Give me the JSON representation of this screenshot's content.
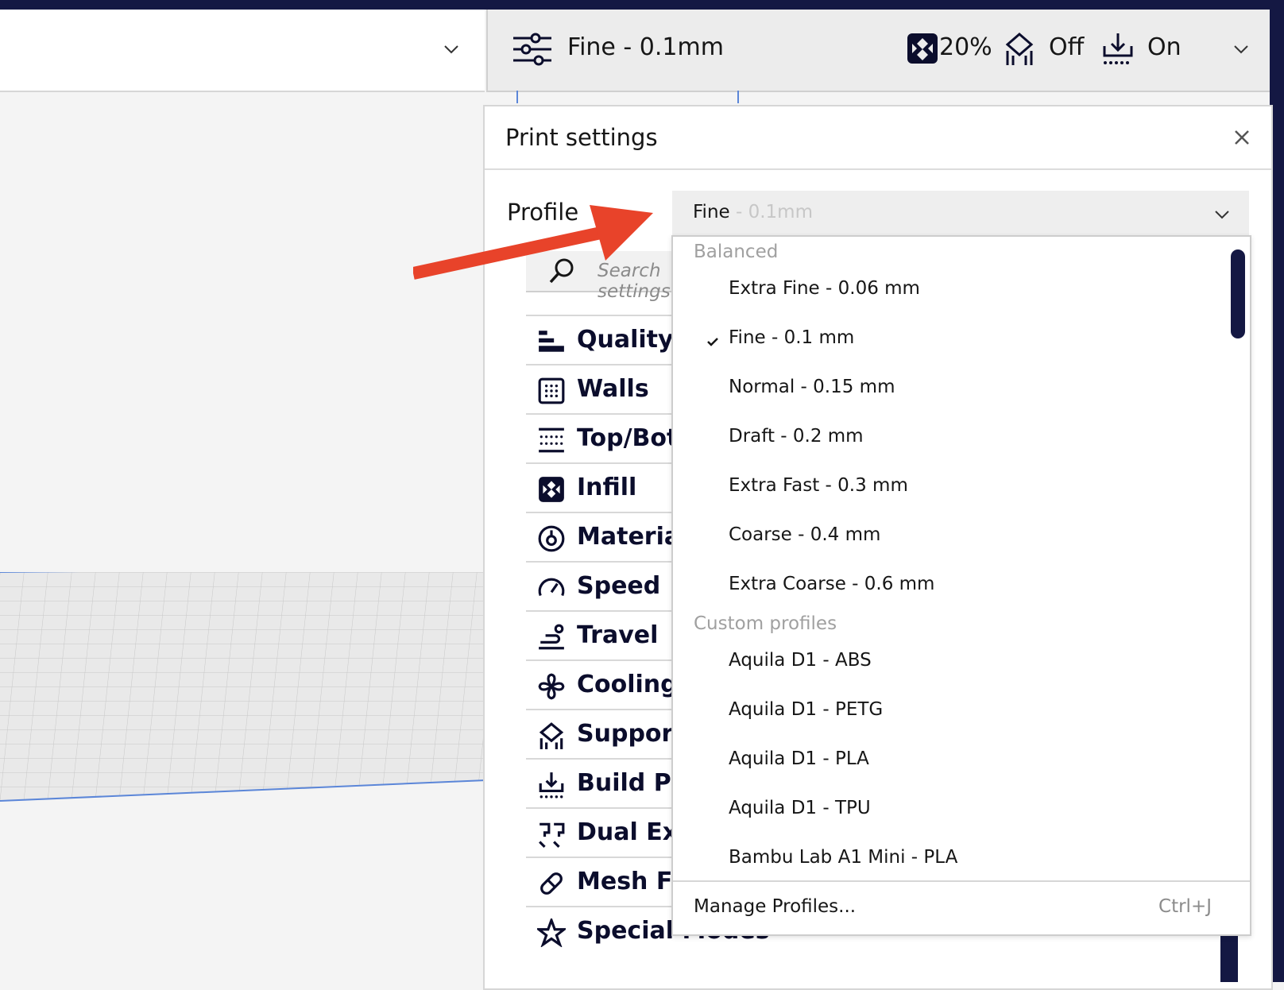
{
  "stage_bar": {
    "profile_label": "Fine - 0.1mm",
    "infill_value": "20%",
    "support_value": "Off",
    "adhesion_value": "On"
  },
  "panel": {
    "title": "Print settings",
    "profile_label": "Profile",
    "profile_value": "Fine",
    "profile_value_sub": " - 0.1mm",
    "search_placeholder": "Search settings",
    "categories": [
      {
        "label": "Quality",
        "icon": "quality-icon"
      },
      {
        "label": "Walls",
        "icon": "walls-icon"
      },
      {
        "label": "Top/Bottom",
        "icon": "top-bottom-icon"
      },
      {
        "label": "Infill",
        "icon": "infill-icon"
      },
      {
        "label": "Material",
        "icon": "material-icon"
      },
      {
        "label": "Speed",
        "icon": "speed-icon"
      },
      {
        "label": "Travel",
        "icon": "travel-icon"
      },
      {
        "label": "Cooling",
        "icon": "cooling-icon"
      },
      {
        "label": "Support",
        "icon": "support-icon"
      },
      {
        "label": "Build Plate Adhesion",
        "icon": "build-plate-icon"
      },
      {
        "label": "Dual Extrusion",
        "icon": "dual-extrusion-icon"
      },
      {
        "label": "Mesh Fixes",
        "icon": "mesh-fixes-icon"
      },
      {
        "label": "Special Modes",
        "icon": "special-modes-icon"
      }
    ]
  },
  "dropdown": {
    "group_balanced": "Balanced",
    "group_custom": "Custom profiles",
    "balanced": [
      "Extra Fine - 0.06 mm",
      "Fine - 0.1 mm",
      "Normal - 0.15 mm",
      "Draft - 0.2 mm",
      "Extra Fast - 0.3 mm",
      "Coarse - 0.4 mm",
      "Extra Coarse - 0.6 mm"
    ],
    "selected_index": 1,
    "custom": [
      "Aquila D1 - ABS",
      "Aquila D1 - PETG",
      "Aquila D1 - PLA",
      "Aquila D1 - TPU",
      "Bambu Lab A1 Mini - PLA"
    ],
    "manage_label": "Manage Profiles...",
    "manage_shortcut": "Ctrl+J"
  },
  "colors": {
    "accent_navy": "#141843",
    "arrow_red": "#e8432a",
    "grid_blue": "#5b86d8"
  }
}
